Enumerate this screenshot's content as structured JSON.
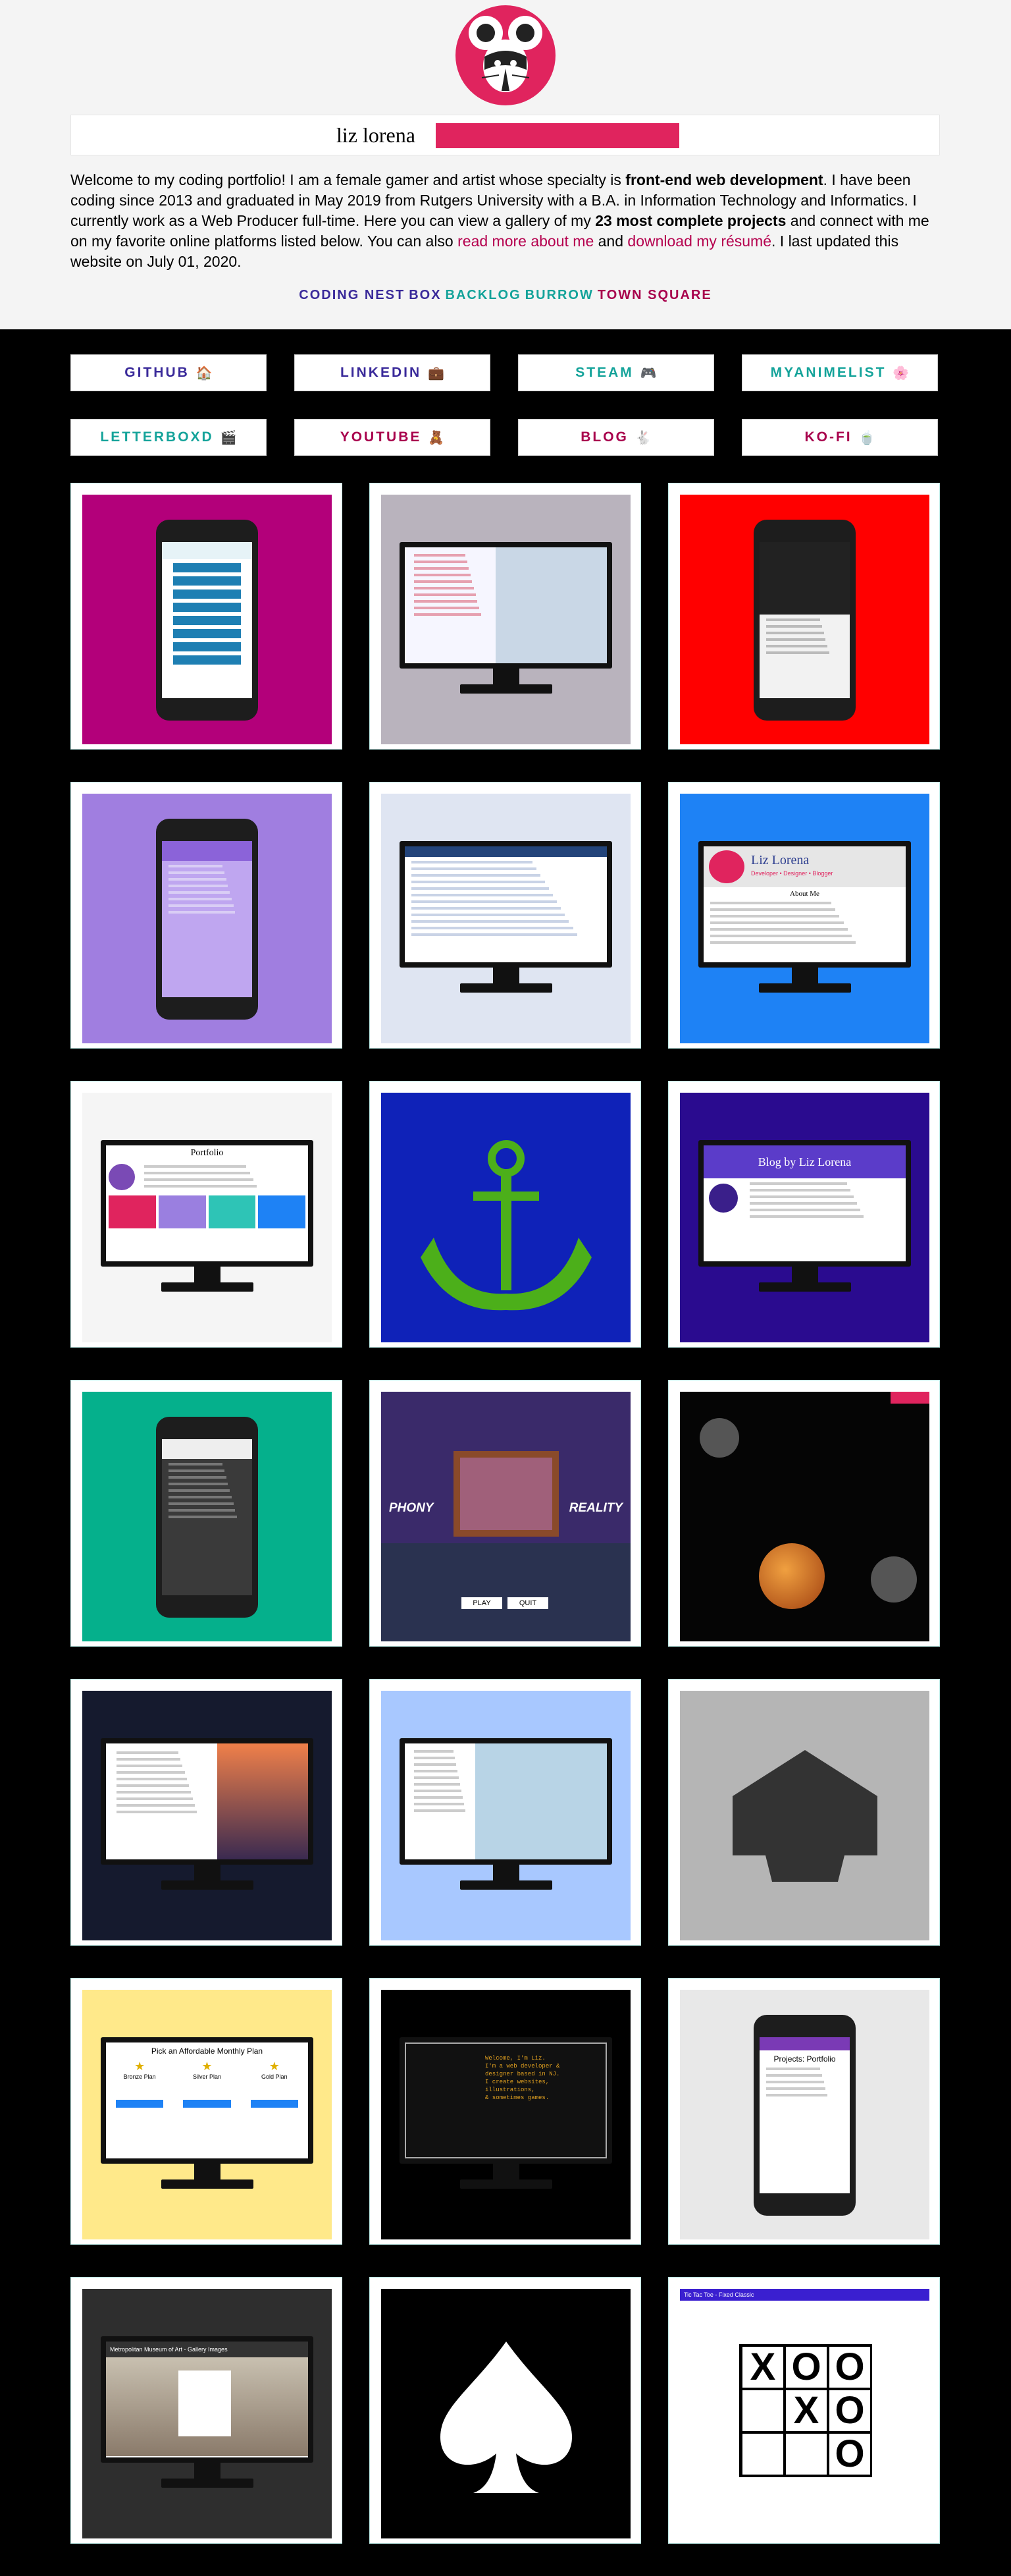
{
  "header": {
    "site_title": "liz lorena",
    "intro_parts": {
      "p1": "Welcome to my coding portfolio! I am a female gamer and artist whose specialty is ",
      "b1": "front-end web development",
      "p2": ". I have been coding since 2013 and graduated in May 2019 from Rutgers University with a B.A. in Information Technology and Informatics. I currently work as a Web Producer full-time. Here you can view a gallery of my ",
      "b2": "23 most complete projects",
      "p3": " and connect with me on my favorite online platforms listed below. You can also ",
      "l1": "read more about me",
      "p4": " and ",
      "l2": "download my résumé",
      "p5": ". I last updated this website on July 01, 2020."
    },
    "nav_links": [
      "CODING NEST",
      "BOX",
      "BACKLOG",
      "BURROW",
      "TOWN SQUARE"
    ],
    "nav_colors": [
      "#3a2a9a",
      "#3a2a9a",
      "#14a39a",
      "#14a39a",
      "#a8004c"
    ]
  },
  "social": [
    {
      "label": "GITHUB",
      "icon": "🏠",
      "color": "#3a2a9a"
    },
    {
      "label": "LINKEDIN",
      "icon": "💼",
      "color": "#3a2a9a"
    },
    {
      "label": "STEAM",
      "icon": "🎮",
      "color": "#14a39a"
    },
    {
      "label": "MYANIMELIST",
      "icon": "🌸",
      "color": "#14a39a"
    },
    {
      "label": "LETTERBOXD",
      "icon": "🎬",
      "color": "#14a39a"
    },
    {
      "label": "YOUTUBE",
      "icon": "🧸",
      "color": "#a8004c"
    },
    {
      "label": "BLOG",
      "icon": "🐇",
      "color": "#a8004c"
    },
    {
      "label": "KO-FI",
      "icon": "🍵",
      "color": "#a8004c"
    }
  ],
  "tiles": {
    "bg_colors": [
      "#b3007a",
      "#b9b3bd",
      "#ff0000",
      "#a07ee0",
      "#dfe5f2",
      "#1e82f5",
      "#f5f5f5",
      "#0f22b8",
      "#2a0b8f",
      "#05b08c",
      "#3a2a6a",
      "#050505",
      "#151a2e",
      "#a8c8ff",
      "#b5b5b5",
      "#ffe98a",
      "#000000",
      "#e8e8e8",
      "#2e2e2e",
      "#000000",
      "#ffffff"
    ],
    "phony_left": "PHONY",
    "phony_right": "REALITY",
    "phony_play": "PLAY",
    "phony_quit": "QUIT",
    "portfolio_heading": "Portfolio",
    "blog_heading": "Blog by Liz Lorena",
    "about_name": "Liz Lorena",
    "about_tagline": "Developer • Designer • Blogger",
    "about_me": "About Me",
    "plan_heading": "Pick an Affordable Monthly Plan",
    "plan_names": [
      "Bronze Plan",
      "Silver Plan",
      "Gold Plan"
    ],
    "terminal_lines": [
      "Welcome, I'm Liz.",
      "I'm a web developer &",
      "designer based in NJ.",
      "I create websites, illustrations,",
      "& sometimes games."
    ],
    "museum_heading": "Metropolitan Museum of Art - Gallery Images",
    "projects_heading": "Projects: Portfolio",
    "ttt_title": "Tic Tac Toe - Fixed Classic",
    "ttt_board": [
      "X",
      "O",
      "O",
      "",
      "X",
      "O",
      "",
      "",
      "O"
    ]
  }
}
